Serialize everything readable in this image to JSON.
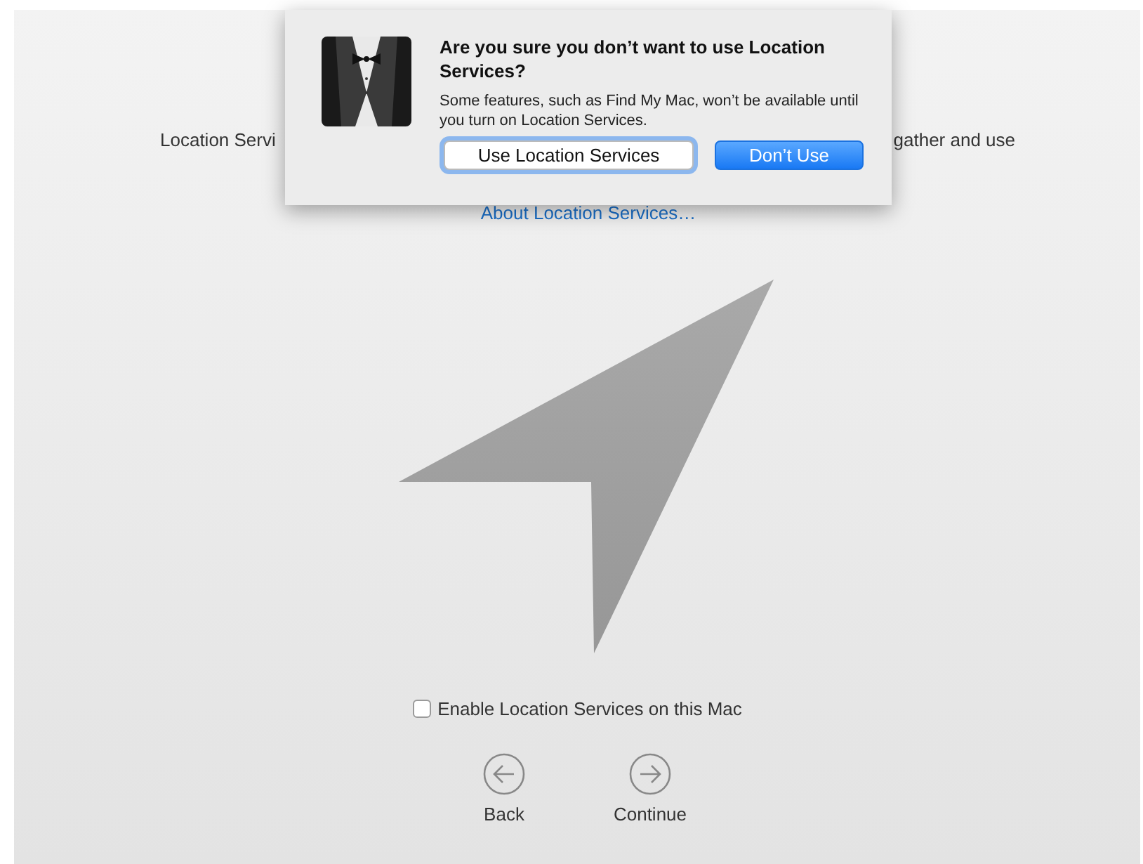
{
  "background_page": {
    "text_left": "Location Servi",
    "text_right": "gather and use",
    "link": "About Location Services…",
    "checkbox": {
      "label": "Enable Location Services on this Mac",
      "checked": false
    },
    "nav": [
      {
        "label": "Back",
        "kind": "back"
      },
      {
        "label": "Continue",
        "kind": "forward"
      }
    ]
  },
  "dialog": {
    "title": "Are you sure you don’t want to use Location Services?",
    "message": "Some features, such as Find My Mac, won’t be available until you turn on Location Services.",
    "buttons": [
      {
        "label": "Use Location Services",
        "selected": true,
        "kind": "secondary"
      },
      {
        "label": "Don’t Use",
        "selected": false,
        "kind": "default"
      }
    ]
  }
}
